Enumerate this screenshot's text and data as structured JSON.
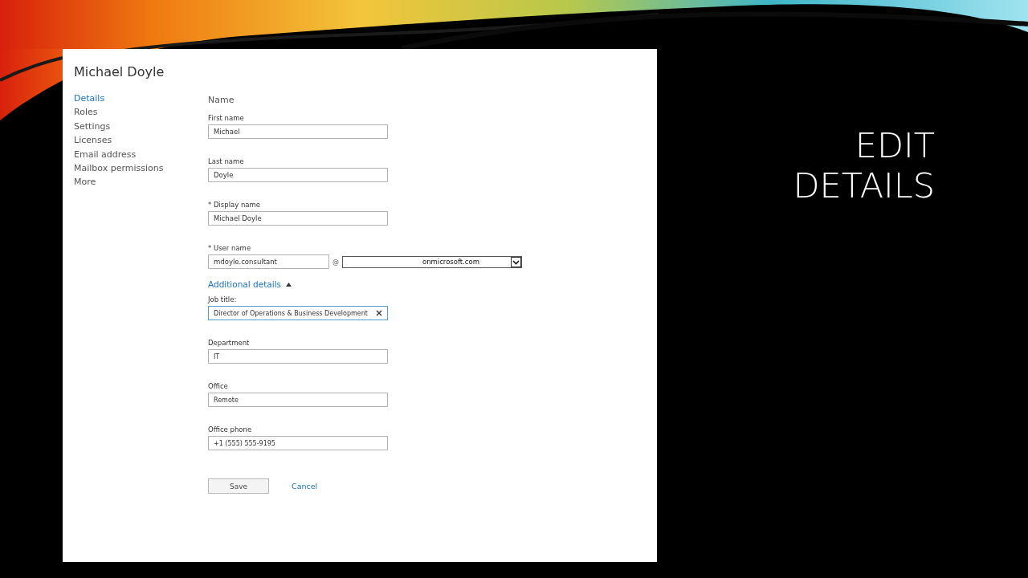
{
  "slide_title": "EDIT DETAILS",
  "panel": {
    "title": "Michael Doyle",
    "nav": [
      {
        "label": "Details",
        "selected": true
      },
      {
        "label": "Roles",
        "selected": false
      },
      {
        "label": "Settings",
        "selected": false
      },
      {
        "label": "Licenses",
        "selected": false
      },
      {
        "label": "Email address",
        "selected": false
      },
      {
        "label": "Mailbox permissions",
        "selected": false
      },
      {
        "label": "More",
        "selected": false
      }
    ],
    "section_heading": "Name",
    "fields": [
      {
        "kind": "text",
        "label": "First name",
        "value": "Michael"
      },
      {
        "kind": "text",
        "label": "Last name",
        "value": "Doyle"
      },
      {
        "kind": "text",
        "label": "* Display name",
        "value": "Michael Doyle"
      },
      {
        "kind": "username",
        "label": "* User name",
        "value": "mdoyle.consultant",
        "separator": "@",
        "domain": "onmicrosoft.com"
      }
    ],
    "additional_details": {
      "label": "Additional details",
      "expanded": true
    },
    "additional_fields": [
      {
        "label": "Job title:",
        "value": "Director of Operations & Business Development",
        "focused": true
      },
      {
        "label": "Department",
        "value": "IT",
        "focused": false
      },
      {
        "label": "Office",
        "value": "Remote",
        "focused": false
      },
      {
        "label": "Office phone",
        "value": "+1 (555) 555-9195",
        "focused": false
      }
    ],
    "save_button": "Save",
    "cancel_link": "Cancel"
  }
}
